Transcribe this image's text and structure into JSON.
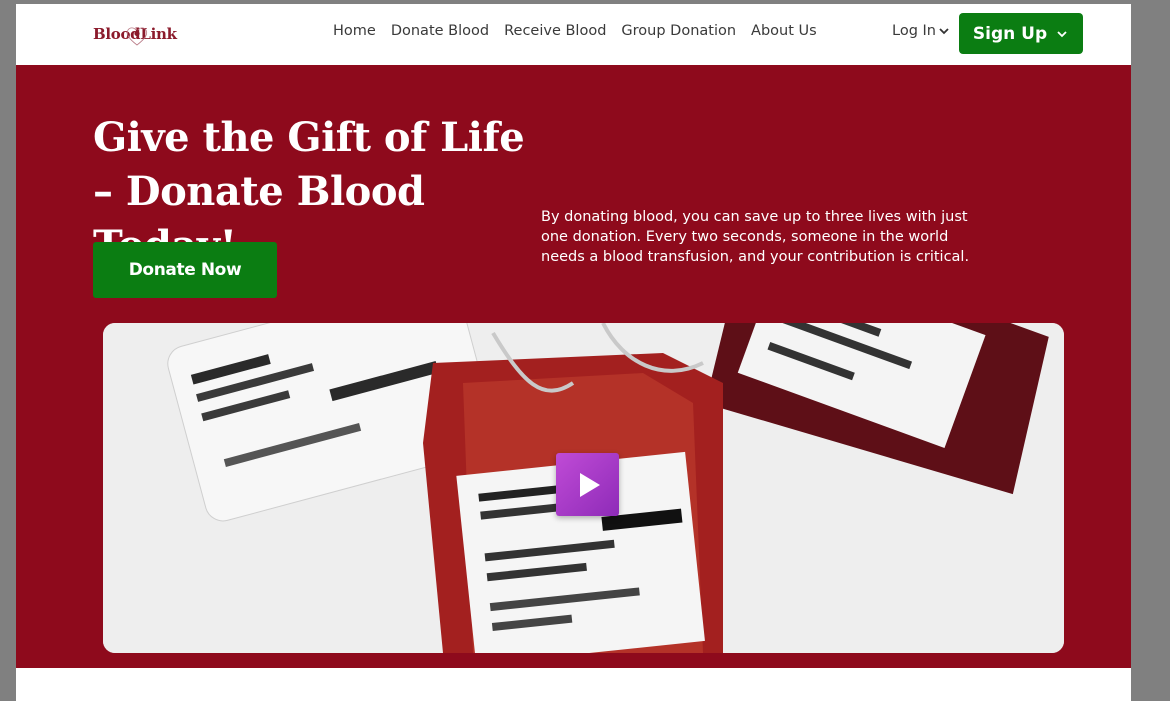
{
  "nav": {
    "logo_text": "BloodLink",
    "links": [
      "Home",
      "Donate Blood",
      "Receive Blood",
      "Group Donation",
      "About Us"
    ],
    "login_label": "Log In",
    "signup_label": "Sign Up"
  },
  "hero": {
    "title": "Give the Gift of Life – Donate Blood Today!",
    "description": "By donating blood, you can save up to three lives with just one donation. Every two seconds, someone in the world needs a blood transfusion, and your contribution is critical.",
    "cta_label": "Donate Now"
  },
  "colors": {
    "brand_red": "#8e0a1c",
    "accent_green": "#0b7d12",
    "play_purple": "#a63bc9"
  },
  "media": {
    "icon": "play-icon"
  }
}
